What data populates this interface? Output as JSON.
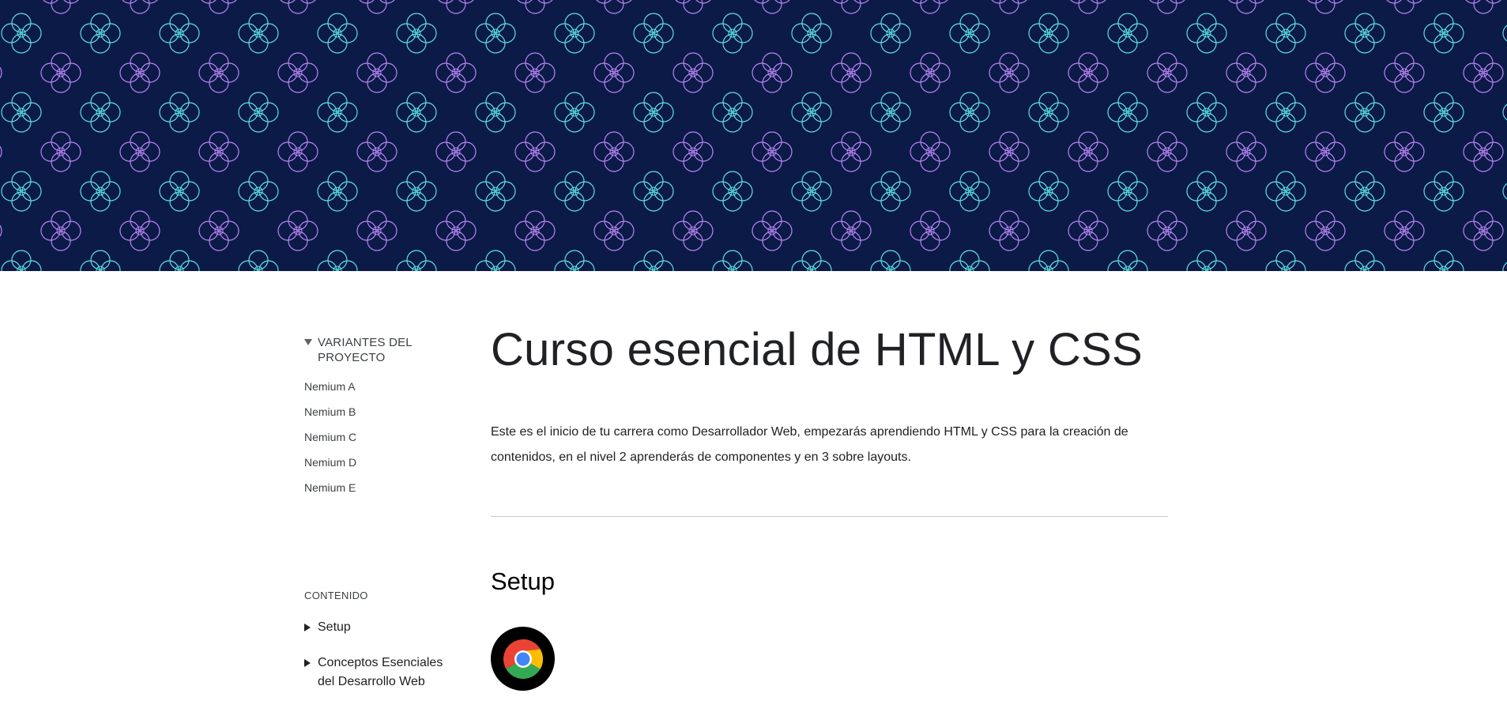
{
  "hero": {
    "background_color": "#0c1a47",
    "pattern_colors": [
      "#5ce1e6",
      "#b685f2",
      "#d6f0f0"
    ]
  },
  "sidebar": {
    "variants_title": "VARIANTES DEL PROYECTO",
    "variants": [
      {
        "label": "Nemium A"
      },
      {
        "label": "Nemium B"
      },
      {
        "label": "Nemium C"
      },
      {
        "label": "Nemium D"
      },
      {
        "label": "Nemium E"
      }
    ],
    "toc_title": "CONTENIDO",
    "toc": [
      {
        "label": "Setup"
      },
      {
        "label": "Conceptos Esenciales del Desarrollo Web"
      }
    ]
  },
  "main": {
    "title": "Curso esencial de HTML y CSS",
    "intro": "Este es el inicio de tu carrera como Desarrollador Web, empezarás aprendiendo HTML y CSS para la creación de contenidos, en el nivel 2 aprenderás de componentes y en 3 sobre layouts.",
    "sections": [
      {
        "title": "Setup",
        "icon": "chrome-icon"
      }
    ]
  }
}
